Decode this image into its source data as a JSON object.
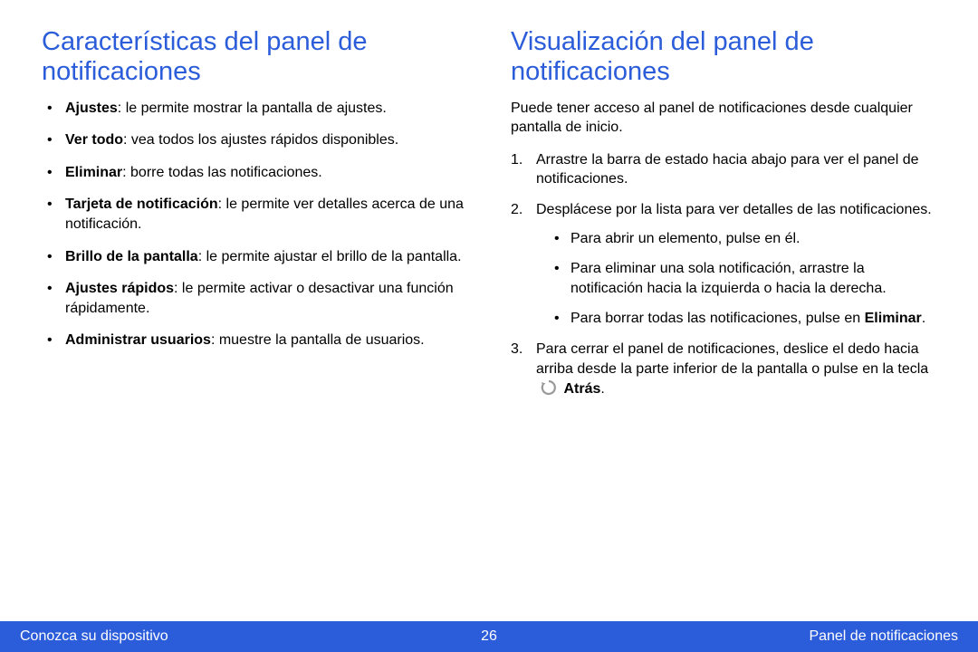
{
  "left": {
    "heading": "Características del panel de notificaciones",
    "items": [
      {
        "bold": "Ajustes",
        "rest": ": le permite mostrar la pantalla de ajustes."
      },
      {
        "bold": "Ver todo",
        "rest": ": vea todos los ajustes rápidos disponibles."
      },
      {
        "bold": "Eliminar",
        "rest": ": borre todas las notificaciones."
      },
      {
        "bold": "Tarjeta de notificación",
        "rest": ": le permite ver detalles acerca de una notificación."
      },
      {
        "bold": "Brillo de la pantalla",
        "rest": ": le permite ajustar el brillo de la pantalla."
      },
      {
        "bold": "Ajustes rápidos",
        "rest": ": le permite activar o desactivar una función rápidamente."
      },
      {
        "bold": "Administrar usuarios",
        "rest": ": muestre la pantalla de usuarios."
      }
    ]
  },
  "right": {
    "heading": "Visualización del panel de notificaciones",
    "intro": "Puede tener acceso al panel de notificaciones desde cualquier pantalla de inicio.",
    "step1": "Arrastre la barra de estado hacia abajo para ver el panel de notificaciones.",
    "step2": "Desplácese por la lista para ver detalles de las notificaciones.",
    "step2_sub": {
      "a": "Para abrir un elemento, pulse en él.",
      "b": "Para eliminar una sola notificación, arrastre la notificación hacia la izquierda o hacia la derecha.",
      "c_pre": "Para borrar todas las notificaciones, pulse en ",
      "c_bold": "Eliminar",
      "c_post": "."
    },
    "step3_pre": "Para cerrar el panel de notificaciones, deslice el dedo hacia arriba desde la parte inferior de la pantalla o pulse en la tecla ",
    "step3_bold": "Atrás",
    "step3_post": "."
  },
  "footer": {
    "left": "Conozca su dispositivo",
    "center": "26",
    "right": "Panel de notificaciones"
  }
}
